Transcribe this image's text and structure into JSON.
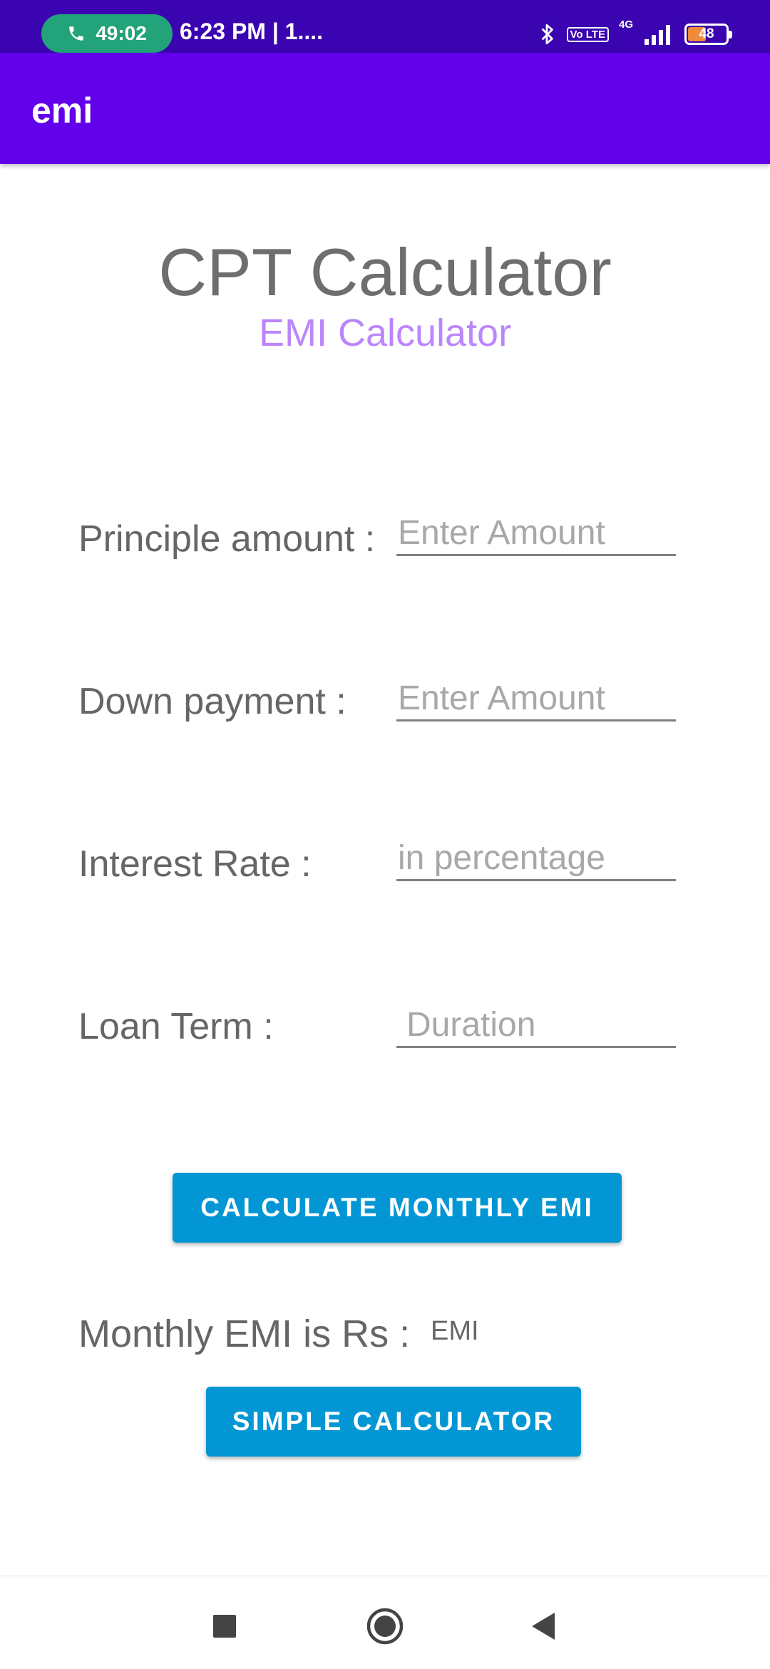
{
  "status_bar": {
    "call_timer": "49:02",
    "time": "6:23 PM | 1....",
    "volte": "Vo LTE",
    "network": "4G",
    "battery": "48"
  },
  "app_bar": {
    "title": "emi"
  },
  "header": {
    "title": "CPT Calculator",
    "subtitle": "EMI Calculator"
  },
  "form": {
    "principal": {
      "label": "Principle amount :",
      "placeholder": "Enter Amount",
      "value": ""
    },
    "down_payment": {
      "label": "Down payment :",
      "placeholder": "Enter Amount",
      "value": ""
    },
    "interest_rate": {
      "label": "Interest Rate :",
      "placeholder": "in percentage",
      "value": ""
    },
    "loan_term": {
      "label": "Loan Term :",
      "placeholder": "Duration",
      "value": ""
    }
  },
  "buttons": {
    "calculate": "CALCULATE MONTHLY EMI",
    "simple": "SIMPLE CALCULATOR"
  },
  "result": {
    "label": "Monthly EMI is Rs :",
    "value": "EMI"
  },
  "colors": {
    "status_bar": "#3a05b0",
    "app_bar": "#6200ea",
    "subtitle": "#bb86fc",
    "button": "#0296d4"
  },
  "icons": {
    "call": "phone-icon",
    "bluetooth": "bluetooth-icon",
    "signal": "signal-icon",
    "nav_recents": "square-icon",
    "nav_home": "circle-icon",
    "nav_back": "triangle-back-icon"
  }
}
